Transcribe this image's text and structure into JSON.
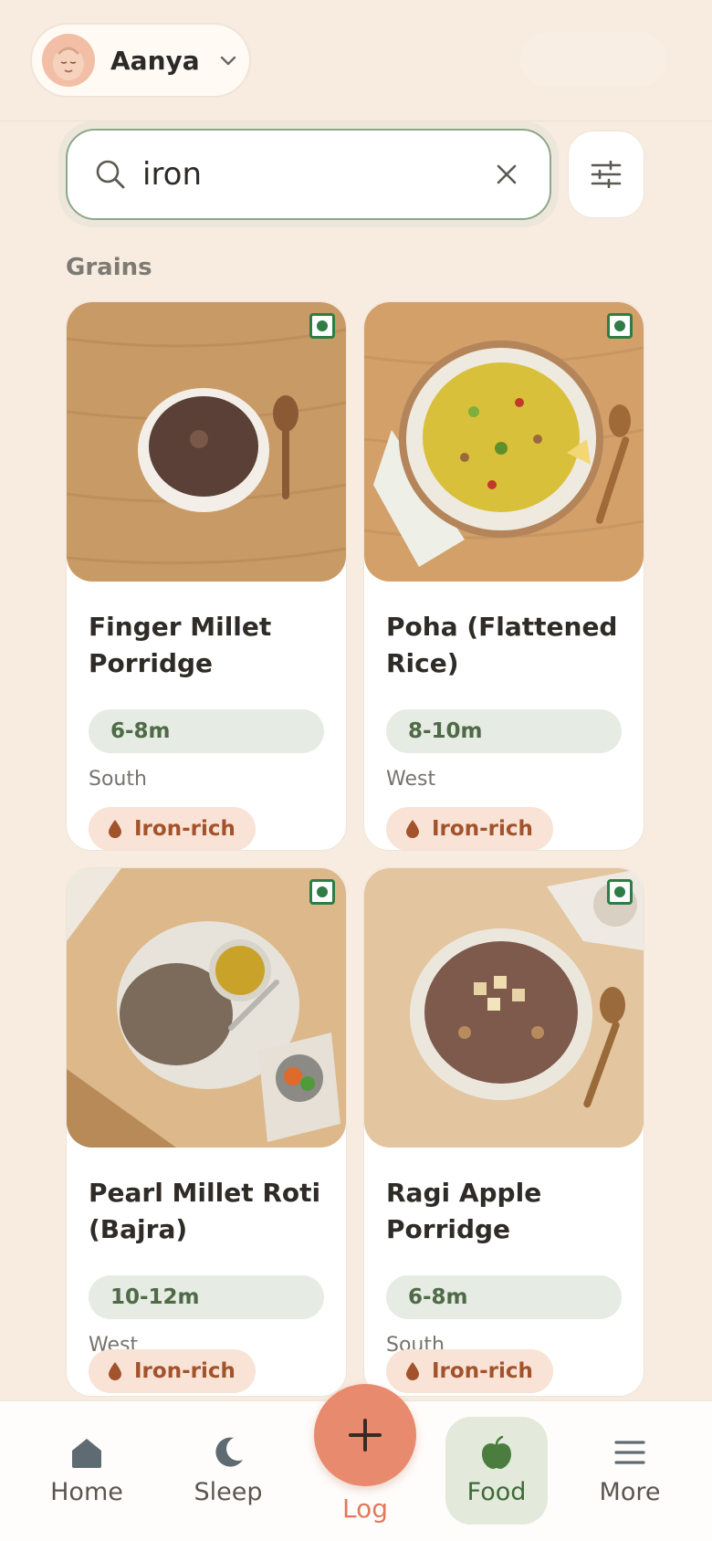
{
  "profile": {
    "name": "Aanya",
    "avatar_icon": "baby-face-icon"
  },
  "search": {
    "query": "iron"
  },
  "section": {
    "title": "Grains"
  },
  "foods": [
    {
      "name": "Finger Millet Porridge",
      "age": "6-8m",
      "region": "South",
      "tag": "Iron-rich",
      "veg": true
    },
    {
      "name": "Poha (Flattened Rice)",
      "age": "8-10m",
      "region": "West",
      "tag": "Iron-rich",
      "veg": true
    },
    {
      "name": "Pearl Millet Roti (Bajra)",
      "age": "10-12m",
      "region": "West",
      "tag": "Iron-rich",
      "veg": true
    },
    {
      "name": "Ragi Apple Porridge",
      "age": "6-8m",
      "region": "South",
      "tag": "Iron-rich",
      "veg": true
    }
  ],
  "nav": {
    "home": "Home",
    "sleep": "Sleep",
    "log": "Log",
    "food": "Food",
    "more": "More",
    "active": "food"
  },
  "colors": {
    "background": "#f7ecdf",
    "accent": "#e88a6e",
    "veg_green": "#2e7d45",
    "age_chip": "#e6ebe3",
    "nutrient_chip": "#f8e3d6"
  }
}
